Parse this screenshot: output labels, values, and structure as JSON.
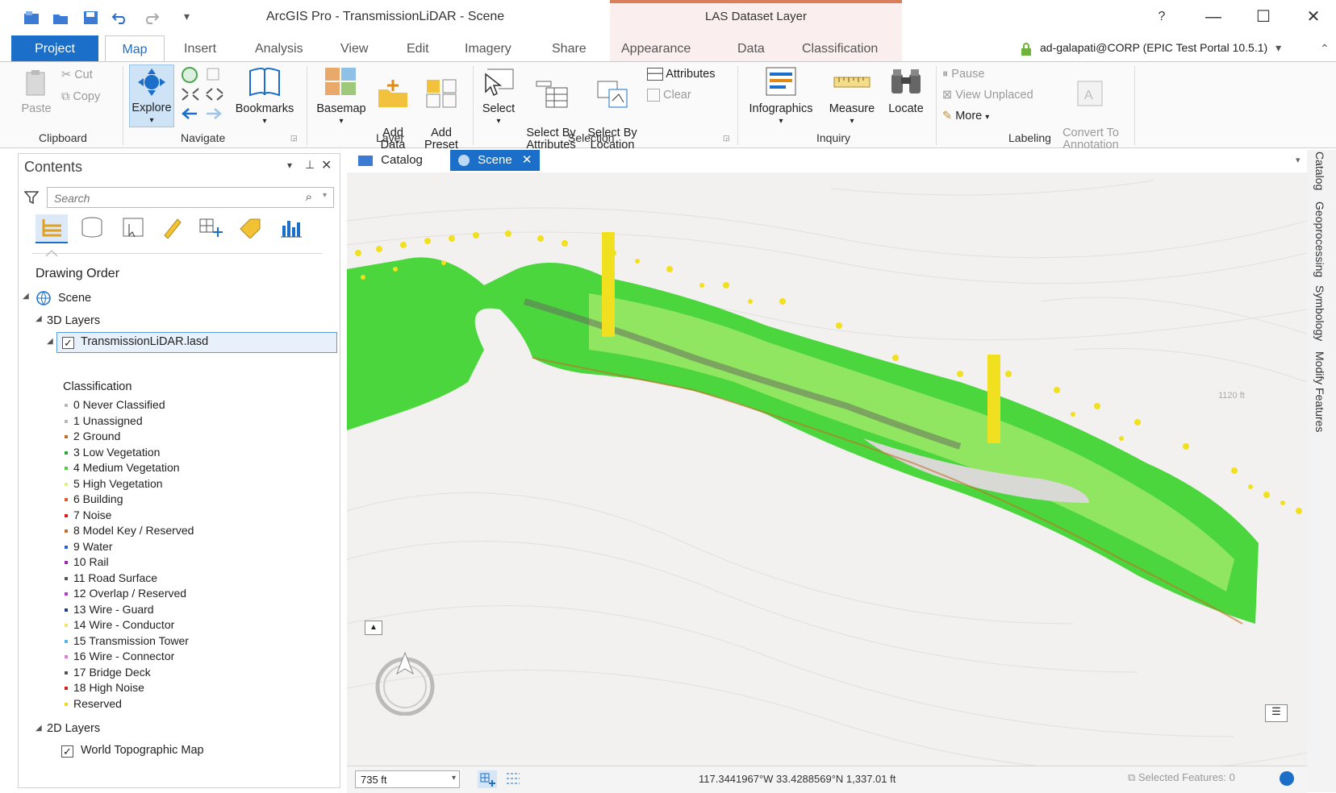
{
  "window": {
    "app_title": "ArcGIS Pro - TransmissionLiDAR - Scene",
    "context_title": "LAS Dataset Layer",
    "help": "?",
    "minimize": "—",
    "maximize": "☐",
    "close": "✕"
  },
  "tabs": {
    "project": "Project",
    "map": "Map",
    "insert": "Insert",
    "analysis": "Analysis",
    "view": "View",
    "edit": "Edit",
    "imagery": "Imagery",
    "share": "Share",
    "appearance": "Appearance",
    "data": "Data",
    "classification": "Classification"
  },
  "user": {
    "label": "ad-galapati@CORP (EPIC Test Portal 10.5.1)",
    "dropdown": "▾",
    "collapse": "⌃"
  },
  "ribbon": {
    "clipboard": {
      "group": "Clipboard",
      "paste": "Paste",
      "cut": "Cut",
      "copy": "Copy"
    },
    "navigate": {
      "group": "Navigate",
      "explore": "Explore",
      "bookmarks": "Bookmarks"
    },
    "layer": {
      "group": "Layer",
      "basemap": "Basemap",
      "add_data": "Add\nData",
      "add_preset": "Add\nPreset"
    },
    "selection": {
      "group": "Selection",
      "select": "Select",
      "select_by_attributes": "Select By\nAttributes",
      "select_by_location": "Select By\nLocation",
      "attributes": "Attributes",
      "clear": "Clear"
    },
    "inquiry": {
      "group": "Inquiry",
      "infographics": "Infographics",
      "measure": "Measure",
      "locate": "Locate"
    },
    "labeling": {
      "group": "Labeling",
      "pause": "Pause",
      "view_unplaced": "View Unplaced",
      "more": "More",
      "convert": "Convert To\nAnnotation"
    }
  },
  "contents": {
    "title": "Contents",
    "search_placeholder": "Search",
    "drawing_order": "Drawing Order",
    "scene": "Scene",
    "layers_3d": "3D Layers",
    "las_layer": "TransmissionLiDAR.lasd",
    "classification_heading": "Classification",
    "classes": [
      {
        "label": "0  Never Classified",
        "color": "#b8b8b8"
      },
      {
        "label": "1  Unassigned",
        "color": "#b8b8b8"
      },
      {
        "label": "2  Ground",
        "color": "#c86a28"
      },
      {
        "label": "3  Low Vegetation",
        "color": "#2eaa3a"
      },
      {
        "label": "4  Medium Vegetation",
        "color": "#4ad63c"
      },
      {
        "label": "5  High Vegetation",
        "color": "#d7f58a"
      },
      {
        "label": "6  Building",
        "color": "#e05a2a"
      },
      {
        "label": "7  Noise",
        "color": "#d42020"
      },
      {
        "label": "8  Model Key / Reserved",
        "color": "#c86a28"
      },
      {
        "label": "9  Water",
        "color": "#2a60d8"
      },
      {
        "label": "10 Rail",
        "color": "#9a2da8"
      },
      {
        "label": "11  Road Surface",
        "color": "#555555"
      },
      {
        "label": "12  Overlap / Reserved",
        "color": "#b23ad2"
      },
      {
        "label": "13  Wire - Guard",
        "color": "#1e3e8a"
      },
      {
        "label": "14  Wire - Conductor",
        "color": "#f3e66a"
      },
      {
        "label": "15  Transmission Tower",
        "color": "#58b6e8"
      },
      {
        "label": "16  Wire - Connector",
        "color": "#e67ad8"
      },
      {
        "label": "17  Bridge Deck",
        "color": "#555555"
      },
      {
        "label": "18  High Noise",
        "color": "#d42020"
      },
      {
        "label": "Reserved",
        "color": "#f0d820"
      }
    ],
    "layers_2d": "2D Layers",
    "topo_layer": "World Topographic Map"
  },
  "views": {
    "catalog": "Catalog",
    "scene": "Scene",
    "contour_label": "1120 ft"
  },
  "dock": {
    "catalog": "Catalog",
    "geoprocessing": "Geoprocessing",
    "symbology": "Symbology",
    "modify": "Modify Features"
  },
  "status": {
    "scale": "735 ft",
    "coordinates": "117.3441967°W 33.4288569°N  1,337.01 ft",
    "selected": "Selected Features: 0"
  },
  "colors": {
    "accent": "#1b6fc9",
    "context_band": "#fbeeee",
    "context_accent": "#d97f5c",
    "veg_medium": "#4ad63c",
    "veg_high": "#d7f58a",
    "wire": "#f0e020"
  }
}
